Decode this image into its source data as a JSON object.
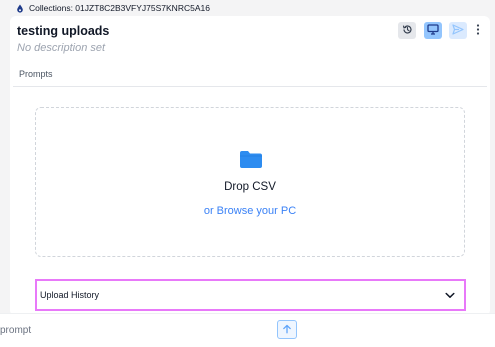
{
  "breadcrumb": {
    "icon": "drop-icon",
    "text": "Collections: 01JZT8C2B3VFYJ75S7KNRC5A16"
  },
  "header": {
    "title": "testing uploads",
    "description": "No description set",
    "actions": [
      {
        "icon": "history-icon",
        "state": "inactive"
      },
      {
        "icon": "monitor-icon",
        "state": "active"
      },
      {
        "icon": "send-icon",
        "state": "disabled"
      },
      {
        "icon": "more-vertical-icon"
      }
    ]
  },
  "tabs": [
    {
      "label": "Prompts"
    }
  ],
  "dropzone": {
    "icon": "folder-icon",
    "title": "Drop CSV",
    "browse_label": "or Browse your PC"
  },
  "upload_history": {
    "label": "Upload History",
    "expanded": false
  },
  "prompt_bar": {
    "placeholder": "prompt",
    "submit_icon": "arrow-up-icon"
  },
  "colors": {
    "accent": "#3b82f6",
    "highlight_border": "#e879f9",
    "active_button": "#93c5fd"
  }
}
